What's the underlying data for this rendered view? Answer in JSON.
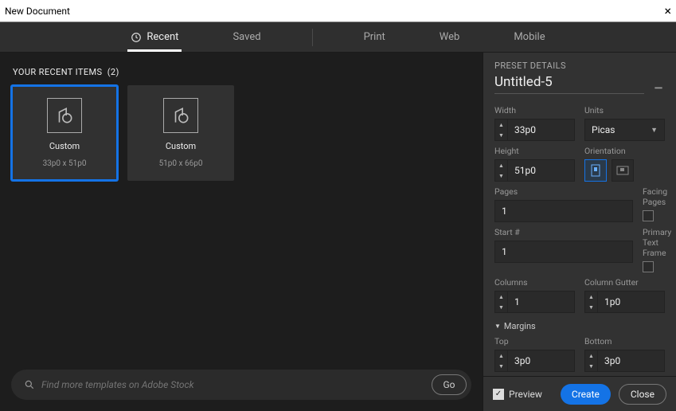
{
  "window": {
    "title": "New Document"
  },
  "tabs": {
    "recent": "Recent",
    "saved": "Saved",
    "print": "Print",
    "web": "Web",
    "mobile": "Mobile",
    "active": "recent"
  },
  "recent": {
    "heading": "YOUR RECENT ITEMS",
    "count": "(2)",
    "items": [
      {
        "name": "Custom",
        "dims": "33p0 x 51p0",
        "selected": true
      },
      {
        "name": "Custom",
        "dims": "51p0 x 66p0",
        "selected": false
      }
    ]
  },
  "search": {
    "placeholder": "Find more templates on Adobe Stock",
    "go": "Go"
  },
  "preset": {
    "heading": "PRESET DETAILS",
    "docname": "Untitled-5",
    "width_label": "Width",
    "width": "33p0",
    "units_label": "Units",
    "units": "Picas",
    "height_label": "Height",
    "height": "51p0",
    "orientation_label": "Orientation",
    "pages_label": "Pages",
    "pages": "1",
    "facing_label": "Facing Pages",
    "facing": false,
    "start_label": "Start #",
    "start": "1",
    "ptf_label": "Primary Text Frame",
    "ptf": false,
    "columns_label": "Columns",
    "columns": "1",
    "gutter_label": "Column Gutter",
    "gutter": "1p0",
    "margins_label": "Margins",
    "top_label": "Top",
    "top": "3p0",
    "bottom_label": "Bottom",
    "bottom": "3p0"
  },
  "footer": {
    "preview": "Preview",
    "preview_checked": true,
    "create": "Create",
    "close": "Close"
  }
}
